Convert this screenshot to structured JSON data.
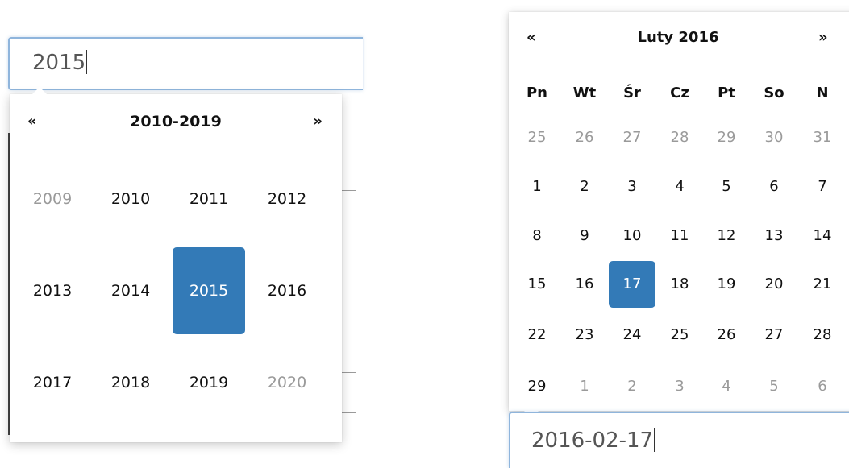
{
  "year_picker": {
    "input_value": "2015",
    "nav": {
      "prev": "«",
      "title": "2010-2019",
      "next": "»"
    },
    "years": [
      {
        "label": "2009",
        "state": "old"
      },
      {
        "label": "2010",
        "state": "normal"
      },
      {
        "label": "2011",
        "state": "normal"
      },
      {
        "label": "2012",
        "state": "normal"
      },
      {
        "label": "2013",
        "state": "normal"
      },
      {
        "label": "2014",
        "state": "normal"
      },
      {
        "label": "2015",
        "state": "active"
      },
      {
        "label": "2016",
        "state": "normal"
      },
      {
        "label": "2017",
        "state": "normal"
      },
      {
        "label": "2018",
        "state": "normal"
      },
      {
        "label": "2019",
        "state": "normal"
      },
      {
        "label": "2020",
        "state": "old"
      }
    ]
  },
  "day_picker": {
    "input_value": "2016-02-17",
    "nav": {
      "prev": "«",
      "title": "Luty 2016",
      "next": "»"
    },
    "weekdays": [
      "Pn",
      "Wt",
      "Śr",
      "Cz",
      "Pt",
      "So",
      "N"
    ],
    "weeks": [
      [
        {
          "d": "25",
          "s": "old"
        },
        {
          "d": "26",
          "s": "old"
        },
        {
          "d": "27",
          "s": "old"
        },
        {
          "d": "28",
          "s": "old"
        },
        {
          "d": "29",
          "s": "old"
        },
        {
          "d": "30",
          "s": "old"
        },
        {
          "d": "31",
          "s": "old"
        }
      ],
      [
        {
          "d": "1",
          "s": "day"
        },
        {
          "d": "2",
          "s": "day"
        },
        {
          "d": "3",
          "s": "day"
        },
        {
          "d": "4",
          "s": "day"
        },
        {
          "d": "5",
          "s": "day"
        },
        {
          "d": "6",
          "s": "day"
        },
        {
          "d": "7",
          "s": "day"
        }
      ],
      [
        {
          "d": "8",
          "s": "day"
        },
        {
          "d": "9",
          "s": "day"
        },
        {
          "d": "10",
          "s": "day"
        },
        {
          "d": "11",
          "s": "day"
        },
        {
          "d": "12",
          "s": "day"
        },
        {
          "d": "13",
          "s": "day"
        },
        {
          "d": "14",
          "s": "day"
        }
      ],
      [
        {
          "d": "15",
          "s": "day"
        },
        {
          "d": "16",
          "s": "day"
        },
        {
          "d": "17",
          "s": "active"
        },
        {
          "d": "18",
          "s": "day"
        },
        {
          "d": "19",
          "s": "day"
        },
        {
          "d": "20",
          "s": "day"
        },
        {
          "d": "21",
          "s": "day"
        }
      ],
      [
        {
          "d": "22",
          "s": "day"
        },
        {
          "d": "23",
          "s": "day"
        },
        {
          "d": "24",
          "s": "day"
        },
        {
          "d": "25",
          "s": "day"
        },
        {
          "d": "26",
          "s": "day"
        },
        {
          "d": "27",
          "s": "day"
        },
        {
          "d": "28",
          "s": "day"
        }
      ],
      [
        {
          "d": "29",
          "s": "day"
        },
        {
          "d": "1",
          "s": "new"
        },
        {
          "d": "2",
          "s": "new"
        },
        {
          "d": "3",
          "s": "new"
        },
        {
          "d": "4",
          "s": "new"
        },
        {
          "d": "5",
          "s": "new"
        },
        {
          "d": "6",
          "s": "new"
        }
      ]
    ]
  },
  "colors": {
    "accent": "#337ab7",
    "muted_text": "#9a9a9a",
    "focus_border": "#8fb5dc"
  }
}
